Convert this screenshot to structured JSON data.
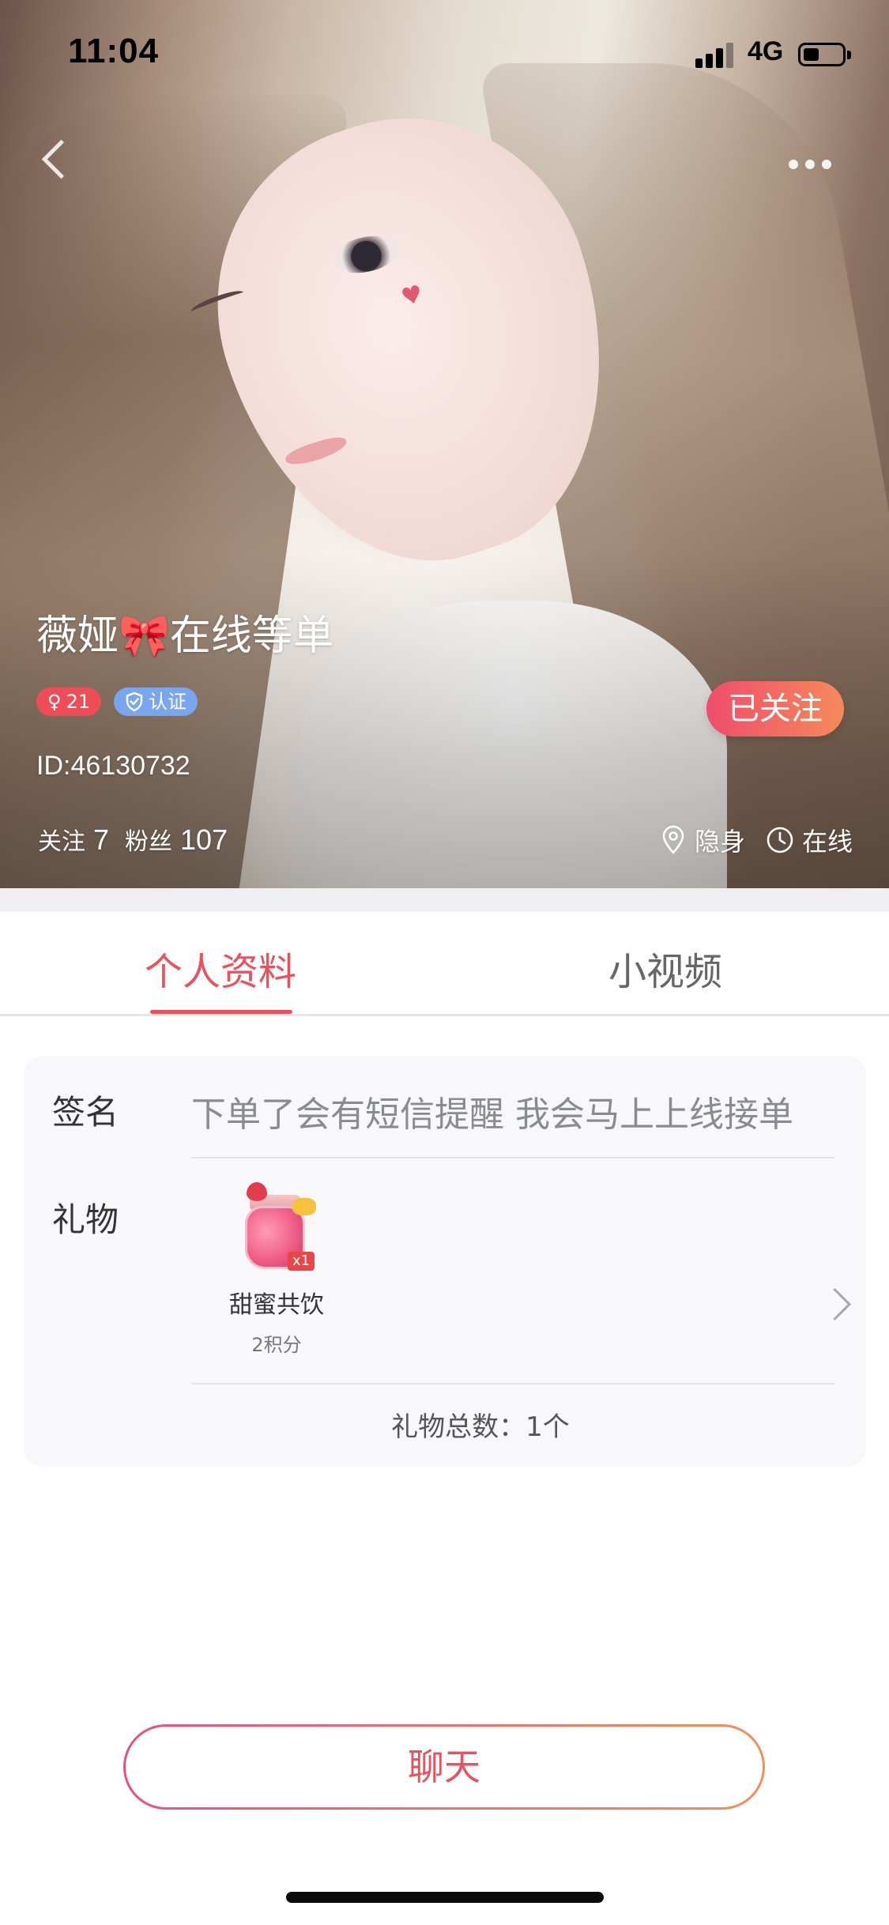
{
  "status_bar": {
    "time": "11:04",
    "network": "4G",
    "battery_level": 0.4
  },
  "profile": {
    "nickname": "薇娅🎀在线等单",
    "gender_icon": "♀",
    "age": "21",
    "verified_label": "认证",
    "user_id": "ID:46130732",
    "following_label": "关注",
    "following_count": "7",
    "fans_label": "粉丝",
    "fans_count": "107",
    "location_status": "隐身",
    "online_status": "在线",
    "follow_button_label": "已关注"
  },
  "tabs": [
    {
      "label": "个人资料",
      "active": true
    },
    {
      "label": "小视频",
      "active": false
    }
  ],
  "info": {
    "signature_label": "签名",
    "signature_text": "下单了会有短信提醒 我会马上上线接单",
    "gift_label": "礼物",
    "gifts": [
      {
        "name": "甜蜜共饮",
        "price": "2积分",
        "quantity": "x1"
      }
    ],
    "gift_total": "礼物总数：1个"
  },
  "chat_button_label": "聊天",
  "colors": {
    "accent": "#e9525c",
    "gender_badge": "#ee4d58",
    "verify_badge": "#7aa6ef",
    "follow_gradient_start": "#ee4d6c",
    "follow_gradient_end": "#f58a5a"
  },
  "icons": {
    "back": "chevron-left-icon",
    "more": "more-dots-icon",
    "location": "location-pin-icon",
    "clock": "clock-icon",
    "shield": "shield-check-icon",
    "gift_chevron": "chevron-right-icon"
  }
}
